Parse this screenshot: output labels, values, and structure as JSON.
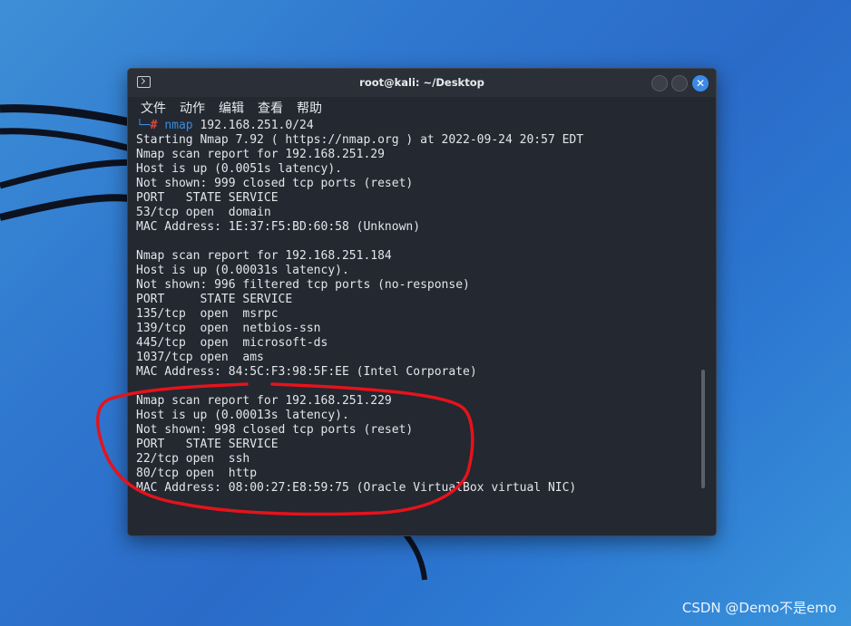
{
  "window": {
    "title": "root@kali: ~/Desktop"
  },
  "menu": {
    "items": [
      "文件",
      "动作",
      "编辑",
      "查看",
      "帮助"
    ]
  },
  "terminal": {
    "prompt": {
      "corner": "└─",
      "hash": "#",
      "command": "nmap",
      "args": " 192.168.251.0/24"
    },
    "lines": [
      "Starting Nmap 7.92 ( https://nmap.org ) at 2022-09-24 20:57 EDT",
      "Nmap scan report for 192.168.251.29",
      "Host is up (0.0051s latency).",
      "Not shown: 999 closed tcp ports (reset)",
      "PORT   STATE SERVICE",
      "53/tcp open  domain",
      "MAC Address: 1E:37:F5:BD:60:58 (Unknown)",
      "",
      "Nmap scan report for 192.168.251.184",
      "Host is up (0.00031s latency).",
      "Not shown: 996 filtered tcp ports (no-response)",
      "PORT     STATE SERVICE",
      "135/tcp  open  msrpc",
      "139/tcp  open  netbios-ssn",
      "445/tcp  open  microsoft-ds",
      "1037/tcp open  ams",
      "MAC Address: 84:5C:F3:98:5F:EE (Intel Corporate)",
      "",
      "Nmap scan report for 192.168.251.229",
      "Host is up (0.00013s latency).",
      "Not shown: 998 closed tcp ports (reset)",
      "PORT   STATE SERVICE",
      "22/tcp open  ssh",
      "80/tcp open  http",
      "MAC Address: 08:00:27:E8:59:75 (Oracle VirtualBox virtual NIC)"
    ]
  },
  "watermark": "CSDN @Demo不是emo",
  "colors": {
    "terminal_bg": "#232831",
    "prompt_accent": "#3a8be0",
    "prompt_hash": "#e2463b",
    "annotation": "#e5131b",
    "close_button": "#3d8ae6"
  }
}
